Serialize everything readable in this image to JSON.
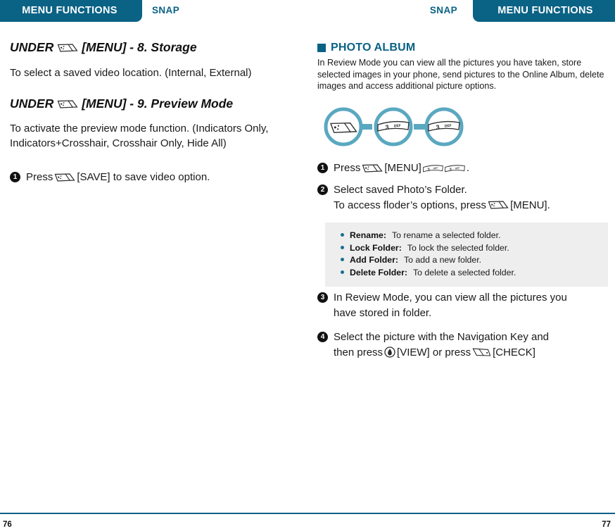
{
  "left_page": {
    "tab_label": "MENU FUNCTIONS",
    "snap_label": "SNAP",
    "page_number": "76",
    "heading_1": {
      "prefix": "UNDER",
      "icon": "softkey-menu-icon",
      "suffix": "[MENU] - 8. Storage"
    },
    "paragraph_1": "To select a saved video location. (Internal, External)",
    "heading_2": {
      "prefix": "UNDER",
      "icon": "softkey-menu-icon",
      "suffix": "[MENU] - 9. Preview Mode"
    },
    "paragraph_2": "To activate the preview mode function. (Indicators Only, Indicators+Crosshair, Crosshair Only, Hide All)",
    "step_1": {
      "number": "1",
      "before_icon": "Press",
      "after_icon": "[SAVE] to save video option."
    }
  },
  "right_page": {
    "tab_label": "MENU FUNCTIONS",
    "snap_label": "SNAP",
    "page_number": "77",
    "section_heading": "PHOTO ALBUM",
    "intro": "In Review Mode you can view all the pictures you have taken, store selected images in your phone, send pictures to the Online Album, delete images and access additional picture options.",
    "key_diagram": {
      "key_1": "softkey-menu-icon",
      "key_2_digit": "3",
      "key_2_letters": "DEF",
      "key_3_digit": "3",
      "key_3_letters": "DEF"
    },
    "steps": [
      {
        "number": "1",
        "text_before": "Press",
        "text_after": "[MENU]",
        "text_end": "."
      },
      {
        "number": "2",
        "line_1": "Select saved Photo’s Folder.",
        "line_2_before": "To access floder’s options, press",
        "line_2_after": "[MENU]."
      },
      {
        "number": "3",
        "line_1": "In Review Mode, you can view all the pictures you",
        "line_2": "have stored in folder."
      },
      {
        "number": "4",
        "line_1": "Select the picture with the Navigation Key and",
        "line_2_a": "then press",
        "line_2_b": "[VIEW] or press",
        "line_2_c": "[CHECK]"
      }
    ],
    "options_box": [
      {
        "label": "Rename:",
        "desc": "To rename a selected folder."
      },
      {
        "label": "Lock Folder:",
        "desc": "To lock the selected folder."
      },
      {
        "label": "Add Folder:",
        "desc": "To add a new folder."
      },
      {
        "label": "Delete Folder:",
        "desc": "To delete a selected folder."
      }
    ]
  },
  "colors": {
    "brand_teal": "#0a6285",
    "diagram_teal": "#5aa8c0",
    "box_gray": "#eeeeee",
    "bullet_teal": "#1a6e92",
    "text": "#1a1a1a"
  }
}
